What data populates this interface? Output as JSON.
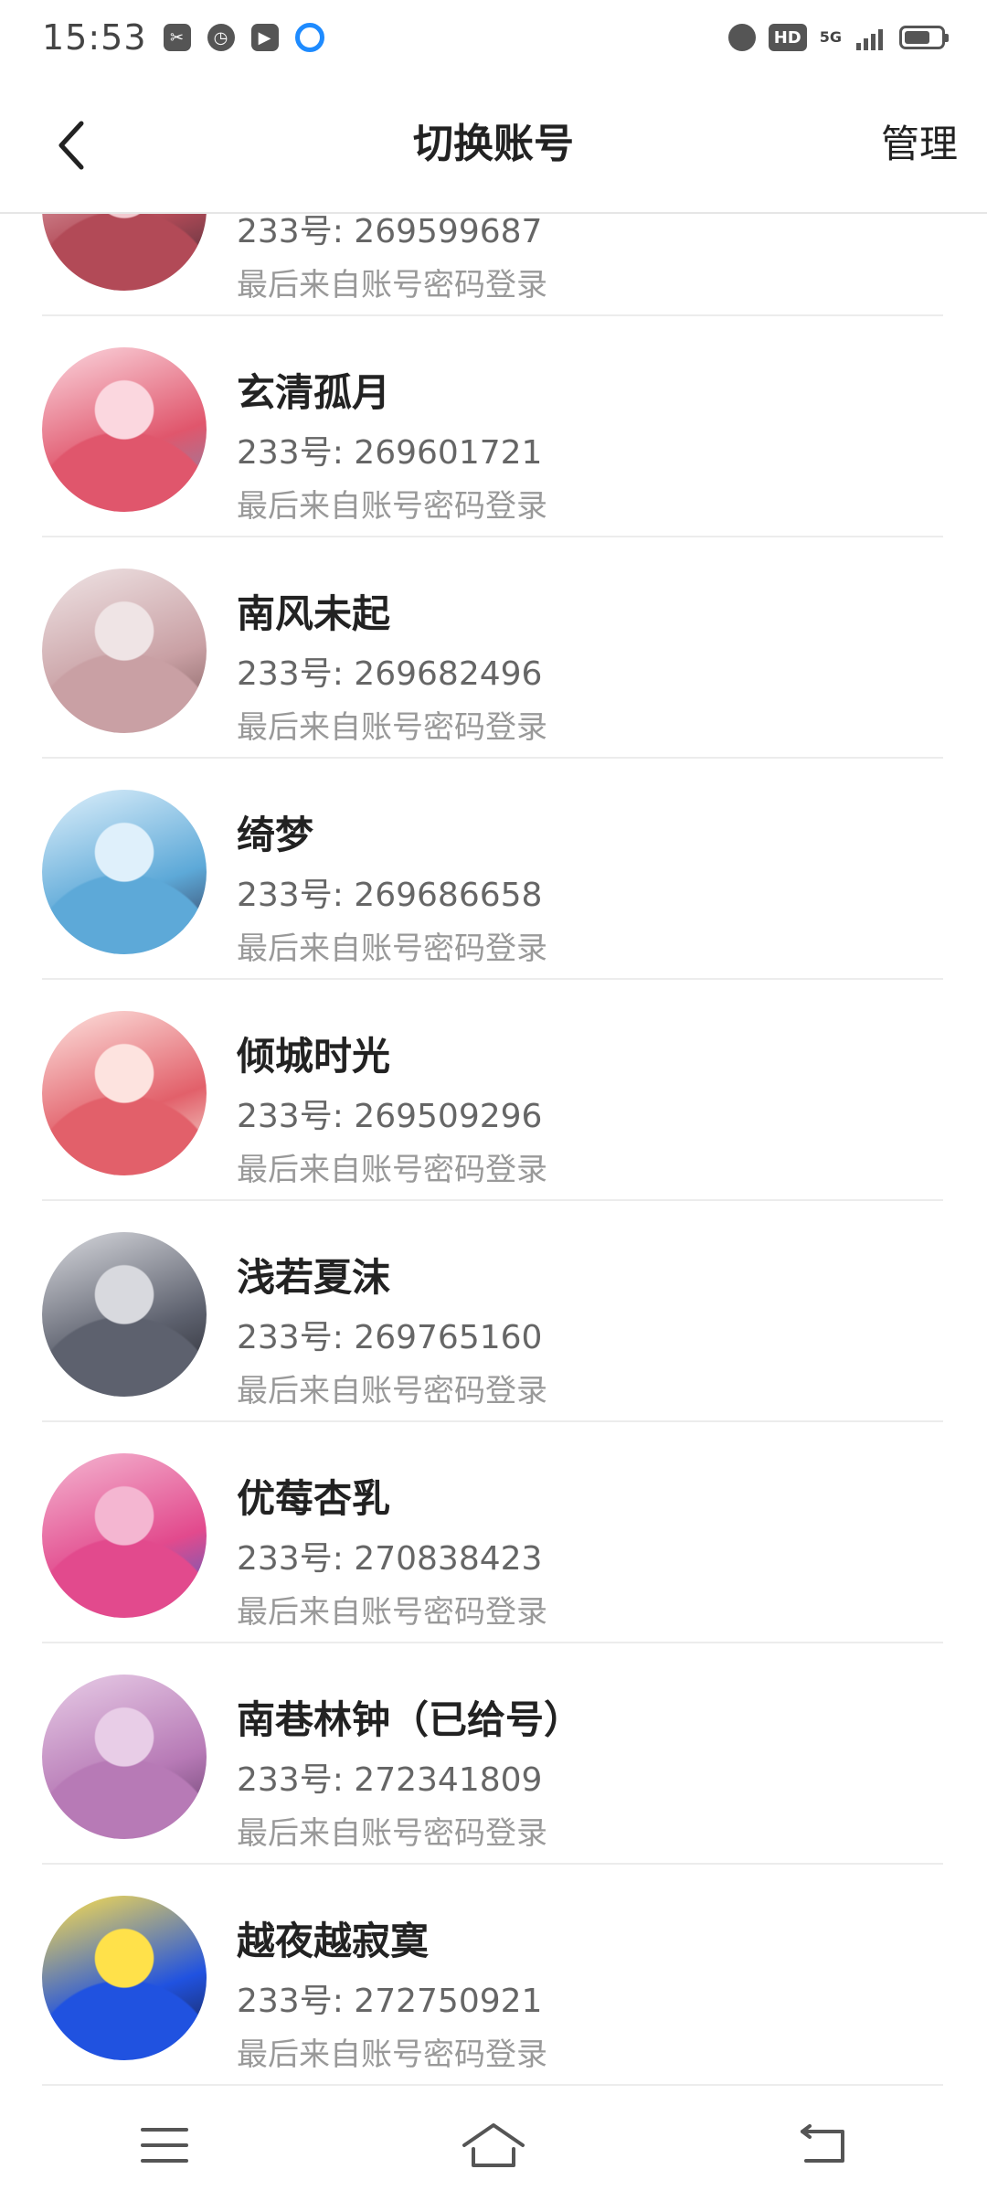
{
  "status_bar": {
    "time": "15:53",
    "network": "5G",
    "hd": "HD",
    "battery_level": 0.7
  },
  "header": {
    "title": "切换账号",
    "manage_label": "管理"
  },
  "accounts": [
    {
      "nickname": "",
      "uid_label": "233号:",
      "uid": "269599687",
      "login_source": "最后来自账号密码登录",
      "avatar_colors": [
        "#f2c9cf",
        "#b24a57",
        "#3a2c36"
      ]
    },
    {
      "nickname": "玄清孤月",
      "uid_label": "233号:",
      "uid": "269601721",
      "login_source": "最后来自账号密码登录",
      "avatar_colors": [
        "#fbd7df",
        "#e0566c",
        "#7b8db1"
      ]
    },
    {
      "nickname": "南风未起",
      "uid_label": "233号:",
      "uid": "269682496",
      "login_source": "最后来自账号密码登录",
      "avatar_colors": [
        "#efe4e5",
        "#c9a0a4",
        "#7a5757"
      ]
    },
    {
      "nickname": "绮梦",
      "uid_label": "233号:",
      "uid": "269686658",
      "login_source": "最后来自账号密码登录",
      "avatar_colors": [
        "#dff0fb",
        "#5da9d8",
        "#2f2d49"
      ]
    },
    {
      "nickname": "倾城时光",
      "uid_label": "233号:",
      "uid": "269509296",
      "login_source": "最后来自账号密码登录",
      "avatar_colors": [
        "#fde3df",
        "#e2606a",
        "#f7f0e3"
      ]
    },
    {
      "nickname": "浅若夏沫",
      "uid_label": "233号:",
      "uid": "269765160",
      "login_source": "最后来自账号密码登录",
      "avatar_colors": [
        "#d8d9de",
        "#5d616e",
        "#24252b"
      ]
    },
    {
      "nickname": "优莓杏乳",
      "uid_label": "233号:",
      "uid": "270838423",
      "login_source": "最后来自账号密码登录",
      "avatar_colors": [
        "#f4b6d1",
        "#e24a8d",
        "#3b63c9"
      ]
    },
    {
      "nickname": "南巷林钟（已给号）",
      "uid_label": "233号:",
      "uid": "272341809",
      "login_source": "最后来自账号密码登录",
      "avatar_colors": [
        "#e8cde7",
        "#b77ab6",
        "#5d3763"
      ]
    },
    {
      "nickname": "越夜越寂寞",
      "uid_label": "233号:",
      "uid": "272750921",
      "login_source": "最后来自账号密码登录",
      "avatar_colors": [
        "#ffe14a",
        "#2052e0",
        "#1a1a2e"
      ]
    }
  ],
  "nav_bar": {
    "icons": [
      "menu-icon",
      "home-icon",
      "back-return-icon"
    ]
  }
}
